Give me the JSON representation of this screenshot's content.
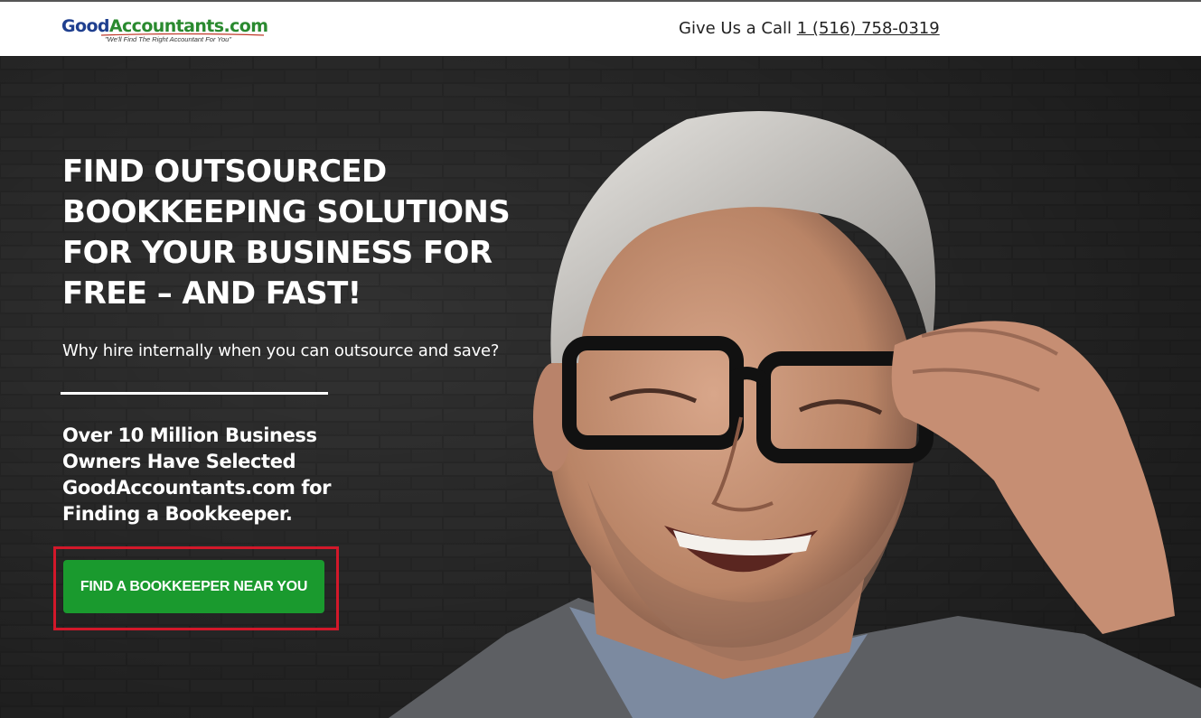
{
  "header": {
    "logo_main_part1": "Good",
    "logo_main_part2": "Accountants.com",
    "logo_tagline": "\"We'll Find The Right Accountant For You\"",
    "call_prefix": "Give Us a Call ",
    "phone": "1 (516) 758-0319"
  },
  "hero": {
    "headline_lines": [
      "FIND OUTSOURCED",
      "BOOKKEEPING SOLUTIONS",
      "FOR YOUR BUSINESS FOR",
      "FREE – AND FAST!"
    ],
    "subhead": "Why hire internally when you can outsource and save?",
    "stats_lines": [
      "Over 10 Million Business",
      "Owners Have Selected",
      "GoodAccountants.com for",
      "Finding a Bookkeeper."
    ],
    "cta_label": "FIND A BOOKKEEPER NEAR YOU"
  },
  "colors": {
    "logo_blue": "#1f3f8f",
    "logo_green": "#2a8a2f",
    "cta_green": "#1a9a2e",
    "highlight_red": "#d2182a",
    "hero_bg": "#2b2b2b"
  }
}
